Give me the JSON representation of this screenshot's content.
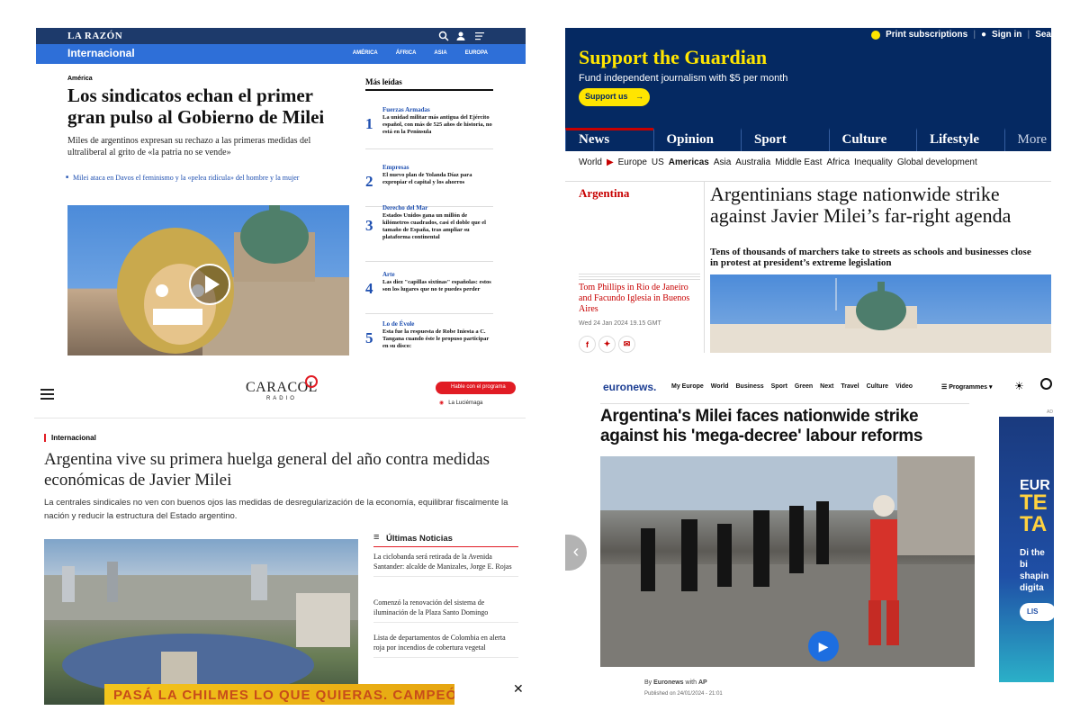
{
  "larazon": {
    "logo": "LA RAZÓN",
    "section": "Internacional",
    "regions": [
      "AMÉRICA",
      "ÁFRICA",
      "ASIA",
      "EUROPA"
    ],
    "kicker": "América",
    "headline": "Los sindicatos echan el primer gran pulso al Gobierno de Milei",
    "subhead": "Miles de argentinos expresan su rechazo a las primeras medidas del ultraliberal al grito de «la patria no se vende»",
    "related": "Milei ataca en Davos el feminismo y la «pelea ridícula» del hombre y la mujer",
    "most_read_title": "Más leídas",
    "most_read": [
      {
        "num": "1",
        "cat": "Fuerzas Armadas",
        "text": "La unidad militar más antigua del Ejército español, con más de 525 años de historia, no está en la Península"
      },
      {
        "num": "2",
        "cat": "Empresas",
        "text": "El nuevo plan de Yolanda Díaz para expropiar el capital y los ahorros"
      },
      {
        "num": "3",
        "cat": "Derecho del Mar",
        "text": "Estados Unidos gana un millón de kilómetros cuadrados, casi el doble que el tamaño de España, tras ampliar su plataforma continental"
      },
      {
        "num": "4",
        "cat": "Arte",
        "text": "Las diez \"capillas sixtinas\" españolas: estos son los lugares que no te puedes perder"
      },
      {
        "num": "5",
        "cat": "Lo de Évole",
        "text": "Esta fue la respuesta de Robe Iniesta a C. Tangana cuando éste le propuso participar en su disco:"
      }
    ]
  },
  "guardian": {
    "print_subscriptions": "Print subscriptions",
    "sign_in": "Sign in",
    "search": "Sea",
    "support_title": "Support the Guardian",
    "support_sub": "Fund independent journalism with $5 per month",
    "support_button": "Support us",
    "pillars": [
      "News",
      "Opinion",
      "Sport",
      "Culture",
      "Lifestyle"
    ],
    "more": "More",
    "subnav": [
      "World",
      "Europe",
      "US",
      "Americas",
      "Asia",
      "Australia",
      "Middle East",
      "Africa",
      "Inequality",
      "Global development"
    ],
    "section": "Argentina",
    "headline": "Argentinians stage nationwide strike against Javier Milei’s far-right agenda",
    "standfirst": "Tens of thousands of marchers take to streets as schools and businesses close in protest at president’s extreme legislation",
    "byline": "Tom Phillips in Rio de Janeiro and Facundo Iglesia in Buenos Aires",
    "date": "Wed 24 Jan 2024 19.15 GMT"
  },
  "caracol": {
    "logo": "CARACOL",
    "logo_sub": "RADIO",
    "habla_btn": "Hable con el programa",
    "program": "La Luciérnaga",
    "kicker": "Internacional",
    "headline": "Argentina vive su primera huelga general del año contra medidas económicas de Javier Milei",
    "lead": "La centrales sindicales no ven con buenos ojos las medidas de desregularización de la economía, equilibrar fiscalmente la nación y reducir la estructura del Estado argentino.",
    "latest_title": "Últimas Noticias",
    "latest": [
      "La ciclobanda será retirada de la Avenida Santander: alcalde de Manizales, Jorge E. Rojas",
      "Comenzó la renovación del sistema de iluminación de la Plaza Santo Domingo",
      "Lista de departamentos de Colombia en alerta roja por incendios de cobertura vegetal"
    ],
    "ad_text": "PASÁ LA CHILMES LO QUE QUIERAS. CAMPEÓN"
  },
  "euronews": {
    "logo": "euronews.",
    "nav": [
      "My Europe",
      "World",
      "Business",
      "Sport",
      "Green",
      "Next",
      "Travel",
      "Culture",
      "Video"
    ],
    "programmes": "Programmes",
    "headline": "Argentina's Milei faces nationwide strike against his 'mega-decree' labour reforms",
    "byline_prefix": "By",
    "byline_source": "Euronews",
    "byline_with": "with",
    "byline_agency": "AP",
    "published": "Published on 24/01/2024 - 21:01",
    "ad_label": "AD",
    "ad_t1": "EUR",
    "ad_t2": "TE TA",
    "ad_t3": "Di the bi shapin digita",
    "ad_btn": "LIS"
  }
}
